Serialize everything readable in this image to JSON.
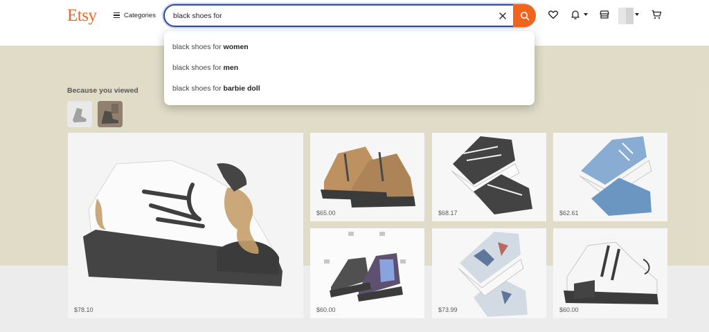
{
  "header": {
    "logo": "Etsy",
    "categories_label": "Categories",
    "search_value": "black shoes for",
    "icons": [
      "clear-icon",
      "search-icon",
      "heart-icon",
      "bell-icon",
      "shop-icon",
      "avatar",
      "cart-icon"
    ]
  },
  "suggestions": [
    {
      "prefix": "black shoes for ",
      "completion": "women"
    },
    {
      "prefix": "black shoes for ",
      "completion": "men"
    },
    {
      "prefix": "black shoes for ",
      "completion": "barbie doll"
    }
  ],
  "section": {
    "title": "Because you viewed"
  },
  "products": [
    {
      "price": "$78.10"
    },
    {
      "price": "$65.00"
    },
    {
      "price": "$68.17"
    },
    {
      "price": "$62.61"
    },
    {
      "price": "$60.00"
    },
    {
      "price": "$73.99"
    },
    {
      "price": "$60.00"
    }
  ],
  "colors": {
    "brand": "#f1641e",
    "focus_border": "#2d4a9e",
    "banner": "#d9d5bc"
  }
}
